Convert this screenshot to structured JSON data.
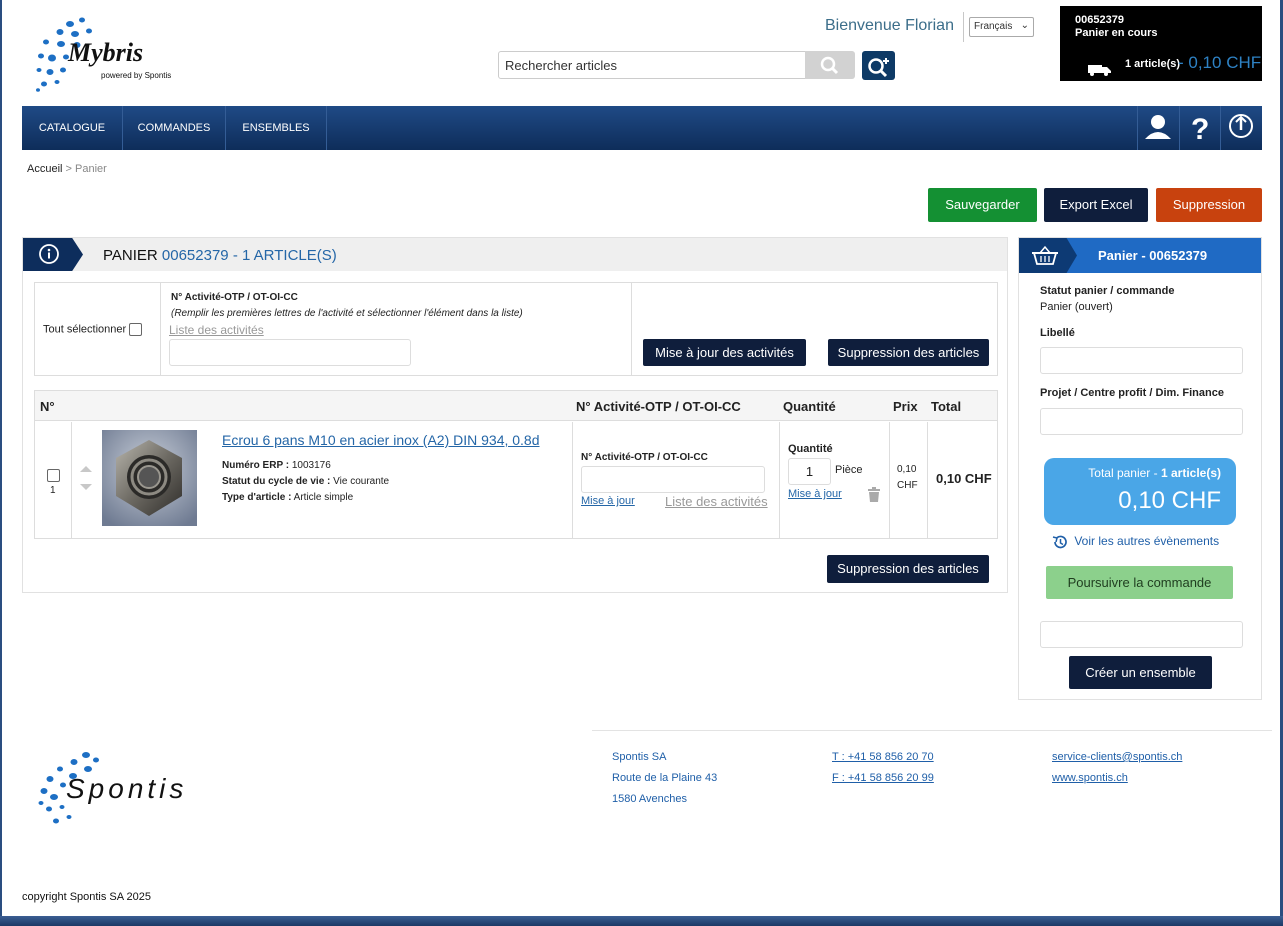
{
  "header": {
    "logo_text": "Mybris",
    "logo_sub": "powered by Spontis",
    "welcome": "Bienvenue Florian",
    "language": "Français",
    "search_placeholder": "Rechercher articles",
    "cart_number": "00652379",
    "cart_status": "Panier en cours",
    "cart_count": "1 article(s)",
    "cart_amount": "- 0,10 CHF"
  },
  "nav": {
    "items": [
      "CATALOGUE",
      "COMMANDES",
      "ENSEMBLES"
    ]
  },
  "breadcrumb": {
    "home": "Accueil",
    "separator": " > ",
    "current": "Panier"
  },
  "actions": {
    "save": "Sauvegarder",
    "export": "Export Excel",
    "delete": "Suppression"
  },
  "panel": {
    "title_prefix": "PANIER",
    "cart_id": "00652379",
    "title_suffix": "-  1 ARTICLE(S)",
    "select_all": "Tout sélectionner",
    "activity_label": "N° Activité-OTP / OT-OI-CC",
    "activity_hint": "(Remplir les premières lettres de l'activité et sélectionner l'élément dans la liste)",
    "activity_list": "Liste des activités",
    "update_activities": "Mise à jour des activités",
    "delete_articles": "Suppression des articles"
  },
  "table": {
    "headers": {
      "num": "N°",
      "activity": "N° Activité-OTP / OT-OI-CC",
      "quantity": "Quantité",
      "price": "Prix",
      "total": "Total"
    },
    "row": {
      "index": "1",
      "title": "Ecrou 6 pans M10 en acier inox (A2) DIN 934, 0.8d",
      "erp_label": "Numéro ERP :",
      "erp_value": "1003176",
      "lifecycle_label": "Statut du cycle de vie :",
      "lifecycle_value": "Vie courante",
      "type_label": "Type d'article :",
      "type_value": "Article simple",
      "activity_label": "N° Activité-OTP / OT-OI-CC",
      "update_link": "Mise à jour",
      "activity_list": "Liste des activités",
      "qty_label": "Quantité",
      "qty_value": "1",
      "qty_unit": "Pièce",
      "qty_update": "Mise à jour",
      "price_value": "0,10",
      "price_currency": "CHF",
      "total": "0,10 CHF"
    }
  },
  "side": {
    "title": "Panier - 00652379",
    "status_label": "Statut panier / commande",
    "status_value": "Panier (ouvert)",
    "libelle_label": "Libellé",
    "project_label": "Projet / Centre profit / Dim. Finance",
    "total_label_prefix": "Total panier - ",
    "total_label_count": "1 article(s)",
    "total_amount": "0,10 CHF",
    "history_link": "Voir les autres évènements",
    "continue_button": "Poursuivre la commande",
    "create_set_button": "Créer un ensemble"
  },
  "footer": {
    "logo_text": "Spontis",
    "company": "Spontis SA",
    "street": "Route de la Plaine 43",
    "city": "1580 Avenches",
    "phone": "T : +41 58 856 20 70",
    "fax": "F : +41 58 856 20 99",
    "email": "service-clients@spontis.ch",
    "website": "www.spontis.ch",
    "copyright": "copyright Spontis SA 2025"
  },
  "colors": {
    "navy": "#0f1e3c",
    "green": "#149033",
    "orange": "#c8420e",
    "accent_blue": "#1f6ac4",
    "light_green": "#8cd08c"
  }
}
